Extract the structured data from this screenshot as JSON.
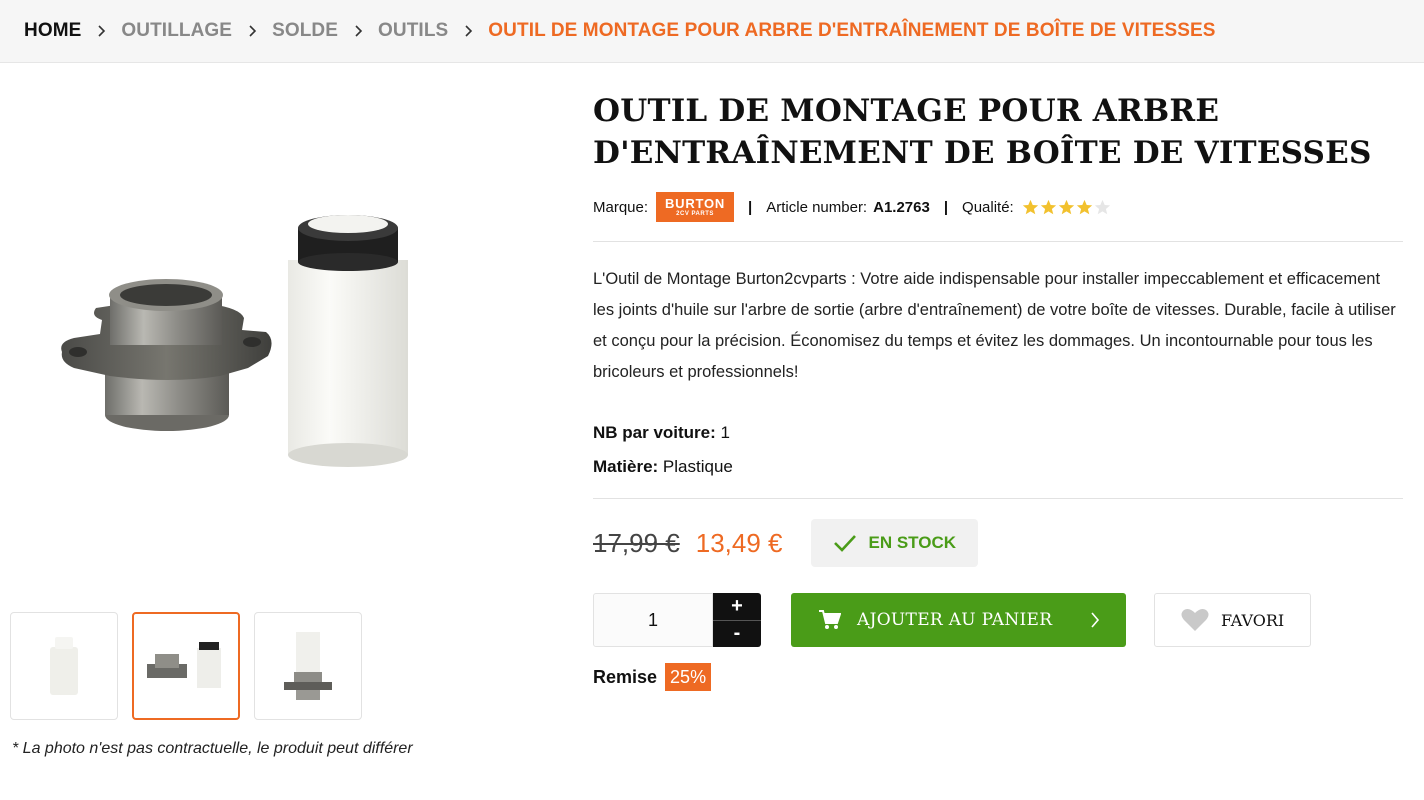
{
  "breadcrumb": {
    "items": [
      "HOME",
      "OUTILLAGE",
      "SOLDE",
      "OUTILS"
    ],
    "current": "OUTIL DE MONTAGE POUR ARBRE D'ENTRAÎNEMENT DE BOÎTE DE VITESSES"
  },
  "product": {
    "title": "OUTIL DE MONTAGE POUR ARBRE D'ENTRAÎNEMENT DE BOÎTE DE VITESSES",
    "brand_label": "Marque:",
    "brand_logo": "BURTON",
    "brand_logo_sub": "2CV PARTS",
    "article_label": "Article number:",
    "article_number": "A1.2763",
    "quality_label": "Qualité:",
    "quality_stars": 4,
    "quality_max": 5,
    "description": "L'Outil de Montage Burton2cvparts : Votre aide indispensable pour installer impeccablement et efficacement les joints d'huile sur l'arbre de sortie (arbre d'entraînement) de votre boîte de vitesses. Durable, facile à utiliser et conçu pour la précision. Économisez du temps et évitez les dommages. Un incontournable pour tous les bricoleurs et professionnels!",
    "specs": {
      "nb_label": "NB par voiture:",
      "nb_value": "1",
      "material_label": "Matière:",
      "material_value": "Plastique"
    },
    "old_price": "17,99 €",
    "price": "13,49 €",
    "stock_label": "EN STOCK",
    "quantity": "1",
    "plus": "+",
    "minus": "-",
    "cart_label": "AJOUTER AU PANIER",
    "favorite_label": "FAVORI",
    "discount_label": "Remise",
    "discount_value": "25%"
  },
  "gallery": {
    "disclaimer": "* La photo n'est pas contractuelle, le produit peut différer",
    "active_thumbnail": 2
  },
  "colors": {
    "accent": "#ee6a23",
    "success": "#4a9c18",
    "star": "#f2c12e"
  }
}
